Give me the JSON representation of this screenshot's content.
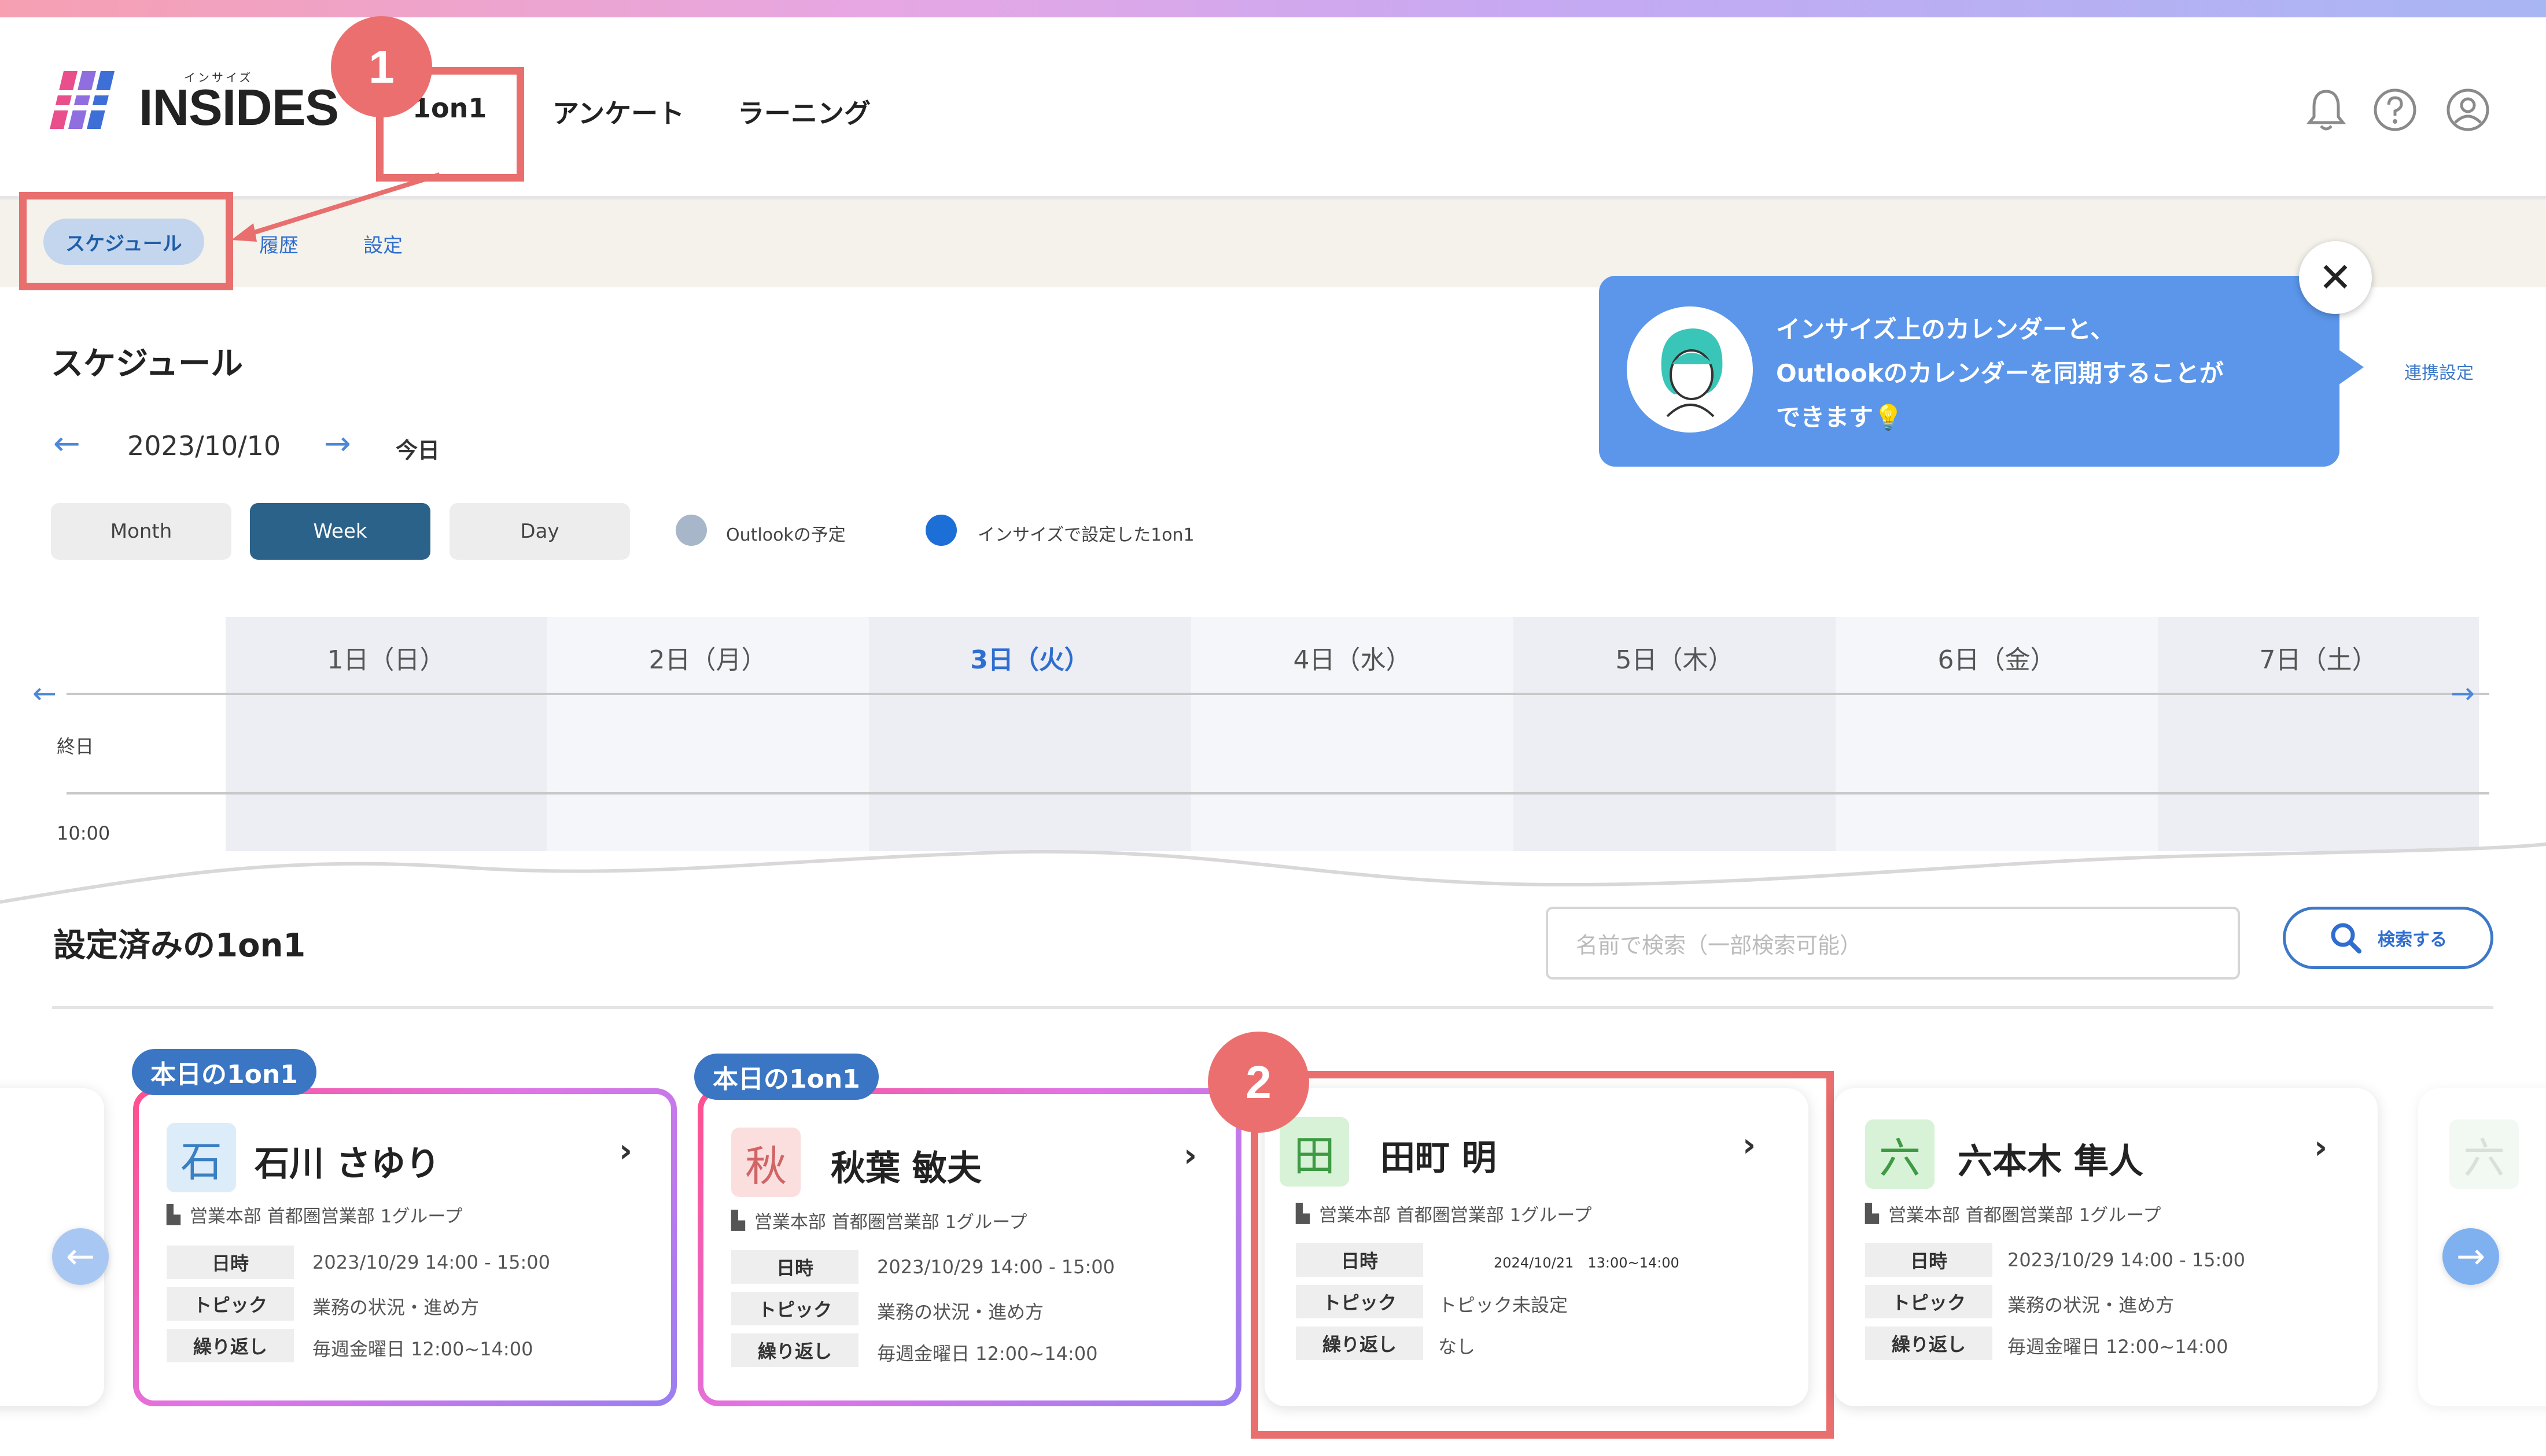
{
  "app": {
    "brand": "INSIDES",
    "brand_kana": "インサイズ"
  },
  "nav": {
    "tabs": [
      "1on1",
      "アンケート",
      "ラーニング"
    ]
  },
  "header_icons": [
    "bell-icon",
    "help-icon",
    "user-icon"
  ],
  "subnav": {
    "items": [
      "スケジュール",
      "履歴",
      "設定"
    ]
  },
  "callouts": {
    "one": "1",
    "two": "2"
  },
  "banner": {
    "line1": "インサイズ上のカレンダーと、",
    "line2": "Outlookのカレンダーを同期することが",
    "line3": "できます💡",
    "link": "連携設定",
    "close": "✕"
  },
  "schedule": {
    "title": "スケジュール",
    "date": "2023/10/10",
    "today": "今日",
    "views": [
      "Month",
      "Week",
      "Day"
    ],
    "active_view": "Week",
    "legend": [
      {
        "label": "Outlookの予定",
        "color": "#a7b6c8"
      },
      {
        "label": "インサイズで設定した1on1",
        "color": "#1c6fd6"
      }
    ],
    "days": [
      "1日（日）",
      "2日（月）",
      "3日（火）",
      "4日（水）",
      "5日（木）",
      "6日（金）",
      "7日（土）"
    ],
    "highlight_day": 2,
    "rows": [
      "終日",
      "10:00"
    ]
  },
  "list": {
    "title": "設定済みの1on1",
    "search_placeholder": "名前で検索（一部検索可能）",
    "search_button": "検索する",
    "today_badge": "本日の1on1",
    "labels": {
      "date": "日時",
      "topic": "トピック",
      "repeat": "繰り返し"
    },
    "cards": [
      {
        "initial": "石",
        "name": "石川 さゆり",
        "dept": "営業本部 首都圏営業部 1グループ",
        "date": "2023/10/29 14:00 - 15:00",
        "topic": "業務の状況・進め方",
        "repeat": "毎週金曜日 12:00~14:00",
        "today": true,
        "avatar_bg": "#dcecf8",
        "avatar_fg": "#3a7fc2"
      },
      {
        "initial": "秋",
        "name": "秋葉 敏夫",
        "dept": "営業本部 首都圏営業部 1グループ",
        "date": "2023/10/29 14:00 - 15:00",
        "topic": "業務の状況・進め方",
        "repeat": "毎週金曜日 12:00~14:00",
        "today": true,
        "avatar_bg": "#fbdede",
        "avatar_fg": "#d06565"
      },
      {
        "initial": "田",
        "name": "田町 明",
        "dept": "営業本部 首都圏営業部 1グループ",
        "date": "2024/10/21　13:00~14:00",
        "topic": "トピック未設定",
        "repeat": "なし",
        "today": false,
        "avatar_bg": "#d7f2d6",
        "avatar_fg": "#3e9a43"
      },
      {
        "initial": "六",
        "name": "六本木 隼人",
        "dept": "営業本部 首都圏営業部 1グループ",
        "date": "2023/10/29 14:00 - 15:00",
        "topic": "業務の状況・進め方",
        "repeat": "毎週金曜日 12:00~14:00",
        "today": false,
        "avatar_bg": "#d7f2d6",
        "avatar_fg": "#3e9a43"
      }
    ],
    "partial_right_initial": "六"
  }
}
